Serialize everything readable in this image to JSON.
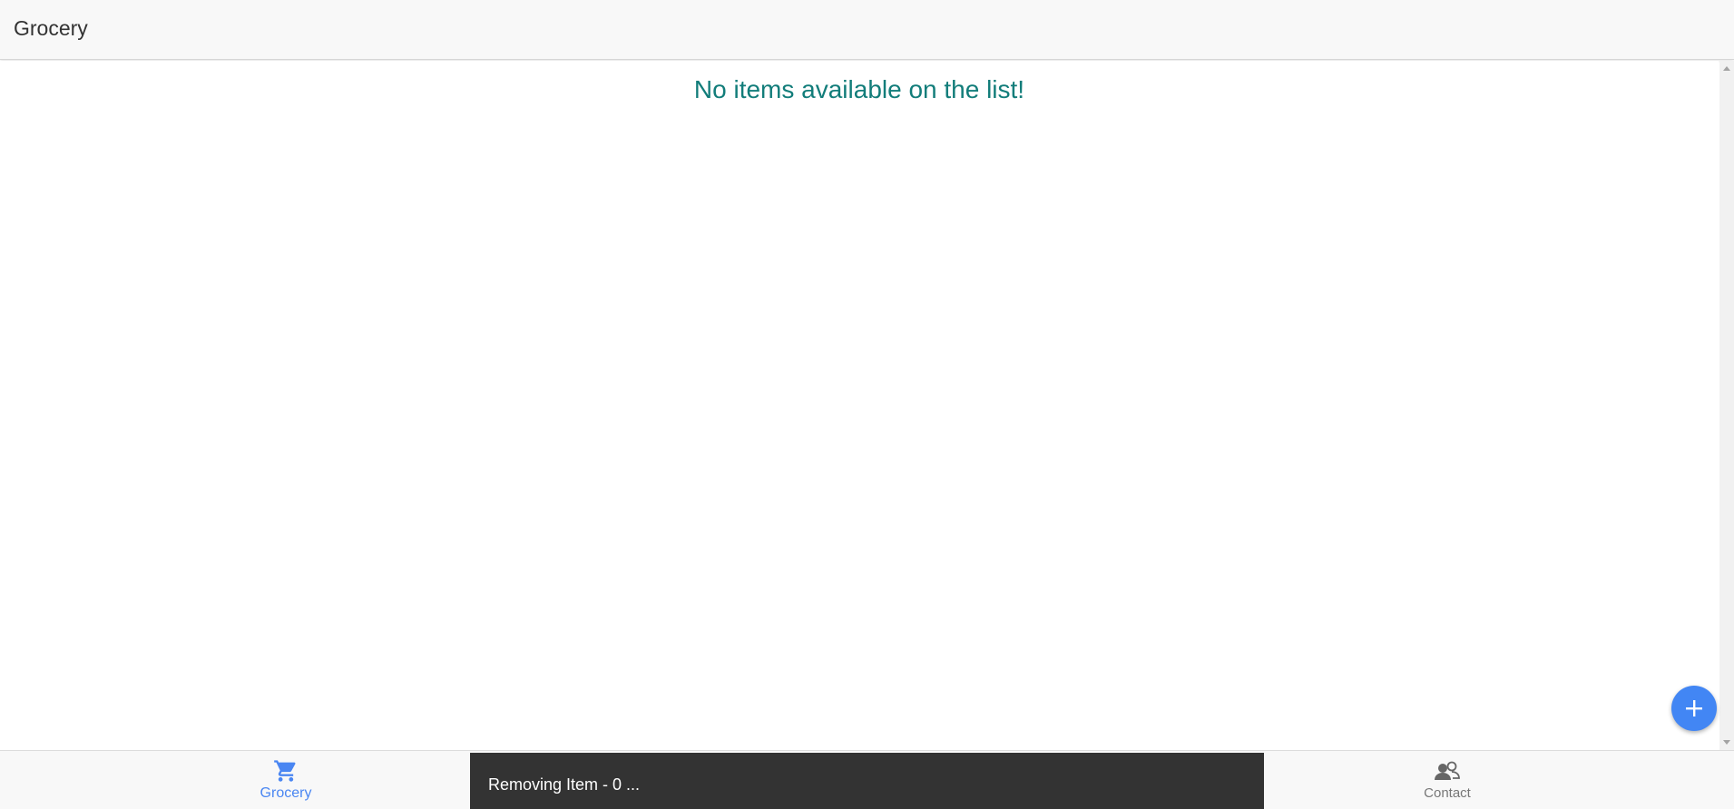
{
  "header": {
    "title": "Grocery"
  },
  "content": {
    "empty_message": "No items available on the list!"
  },
  "fab": {
    "icon": "plus-icon"
  },
  "tabbar": {
    "tabs": [
      {
        "label": "Grocery",
        "icon": "cart-icon",
        "active": true
      },
      {
        "label": "Contact",
        "icon": "contacts-icon",
        "active": false
      }
    ]
  },
  "toast": {
    "message": "Removing Item - 0 ..."
  },
  "colors": {
    "accent": "#4286f4",
    "empty_text": "#127d7a",
    "toast_bg": "#333333"
  }
}
